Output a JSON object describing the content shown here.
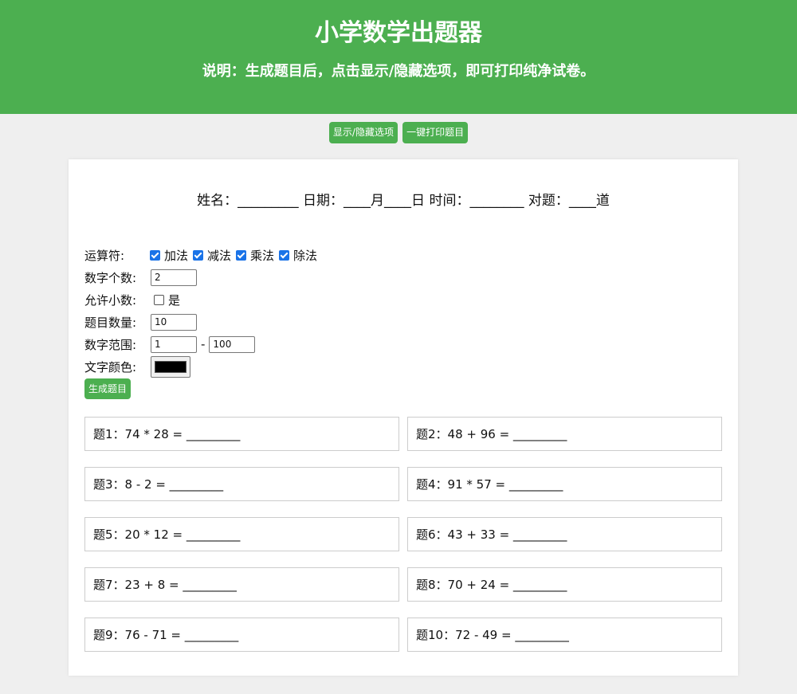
{
  "header": {
    "title": "小学数学出题器",
    "subtitle": "说明：生成题目后，点击显示/隐藏选项，即可打印纯净试卷。"
  },
  "toolbar": {
    "toggle_label": "显示/隐藏选项",
    "print_label": "一键打印题目"
  },
  "student_line": "姓名：_________ 日期：____月____日 时间：________ 对题：____道",
  "options": {
    "operators_label": "运算符:",
    "operators": [
      {
        "label": "加法",
        "checked": true
      },
      {
        "label": "减法",
        "checked": true
      },
      {
        "label": "乘法",
        "checked": true
      },
      {
        "label": "除法",
        "checked": true
      }
    ],
    "num_count_label": "数字个数:",
    "num_count_value": "2",
    "allow_decimal_label": "允许小数:",
    "allow_decimal_option": "是",
    "allow_decimal_checked": false,
    "question_count_label": "题目数量:",
    "question_count_value": "10",
    "range_label": "数字范围:",
    "range_min": "1",
    "range_sep": "-",
    "range_max": "100",
    "text_color_label": "文字颜色:",
    "text_color_value": "#000000",
    "generate_label": "生成题目"
  },
  "questions": [
    "题1：74 * 28 = _________",
    "题2：48 + 96 = _________",
    "题3：8 - 2 = _________",
    "题4：91 * 57 = _________",
    "题5：20 * 12 = _________",
    "题6：43 + 33 = _________",
    "题7：23 + 8 = _________",
    "题8：70 + 24 = _________",
    "题9：76 - 71 = _________",
    "题10：72 - 49 = _________"
  ],
  "colors": {
    "accent": "#4caf50",
    "background": "#efefef",
    "checkbox": "#1a73e8"
  }
}
